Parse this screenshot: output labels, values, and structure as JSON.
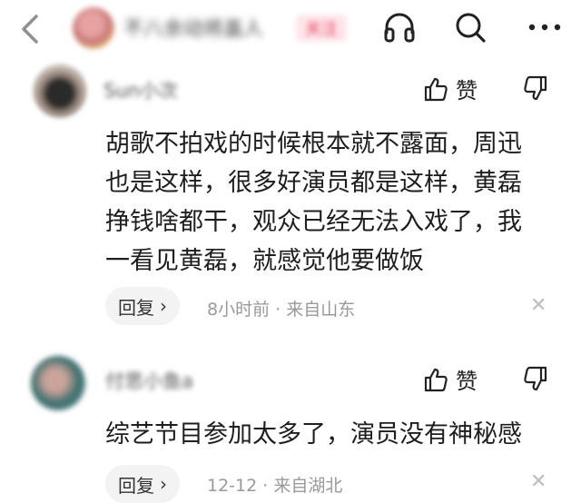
{
  "header": {
    "back_icon": "chevron-left-icon",
    "title": "不八余动将盖人",
    "follow_label": "关注",
    "icons": [
      "headphones-icon",
      "search-icon",
      "more-icon"
    ]
  },
  "comments": [
    {
      "username": "Sun小次",
      "like_label": "赞",
      "text": "胡歌不拍戏的时候根本就不露面，周迅\n也是这样，很多好演员都是这样，黄磊\n挣钱啥都干，观众已经无法入戏了，我\n一看见黄磊，就感觉他要做饭",
      "reply_label": "回复",
      "meta": "8小时前 · 来自山东"
    },
    {
      "username": "付思小鱼a",
      "like_label": "赞",
      "text": "综艺节目参加太多了，演员没有神秘感",
      "reply_label": "回复",
      "meta": "12-12 · 来自湖北"
    }
  ],
  "colors": {
    "accent": "#e94560",
    "meta_gray": "#999999",
    "reply_bg": "#f3f3f3"
  }
}
